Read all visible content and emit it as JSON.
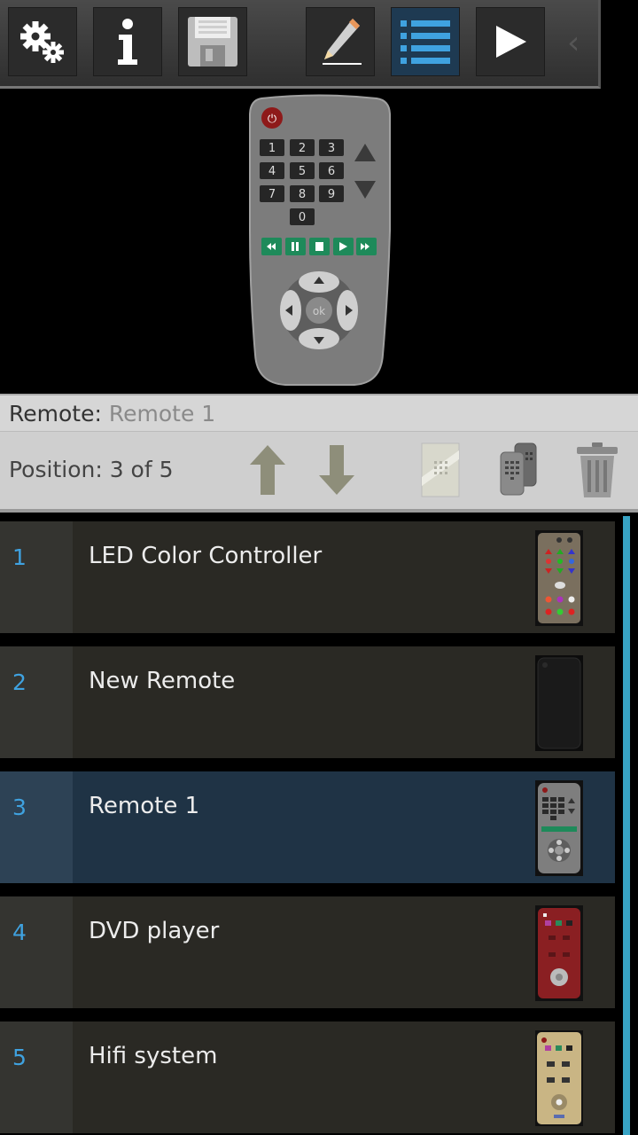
{
  "toolbar": {
    "buttons": [
      {
        "icon": "settings-gears-icon"
      },
      {
        "icon": "info-icon"
      },
      {
        "icon": "save-disk-icon"
      },
      {
        "icon": "edit-pencil-icon"
      },
      {
        "icon": "list-icon",
        "active": true
      },
      {
        "icon": "play-icon"
      }
    ]
  },
  "remote_preview": {
    "number_keys": [
      "1",
      "2",
      "3",
      "4",
      "5",
      "6",
      "7",
      "8",
      "9",
      "0"
    ],
    "ok_label": "ok"
  },
  "remote_bar": {
    "label": "Remote:",
    "value": "Remote 1"
  },
  "position_bar": {
    "text": "Position: 3 of 5"
  },
  "list": {
    "items": [
      {
        "num": "1",
        "name": "LED Color Controller"
      },
      {
        "num": "2",
        "name": "New Remote"
      },
      {
        "num": "3",
        "name": "Remote 1",
        "selected": true
      },
      {
        "num": "4",
        "name": "DVD player"
      },
      {
        "num": "5",
        "name": "Hifi system"
      }
    ]
  },
  "colors": {
    "accent": "#3fa2e0",
    "selected_row": "#1f3345",
    "scrollbar": "#38a3c4"
  }
}
